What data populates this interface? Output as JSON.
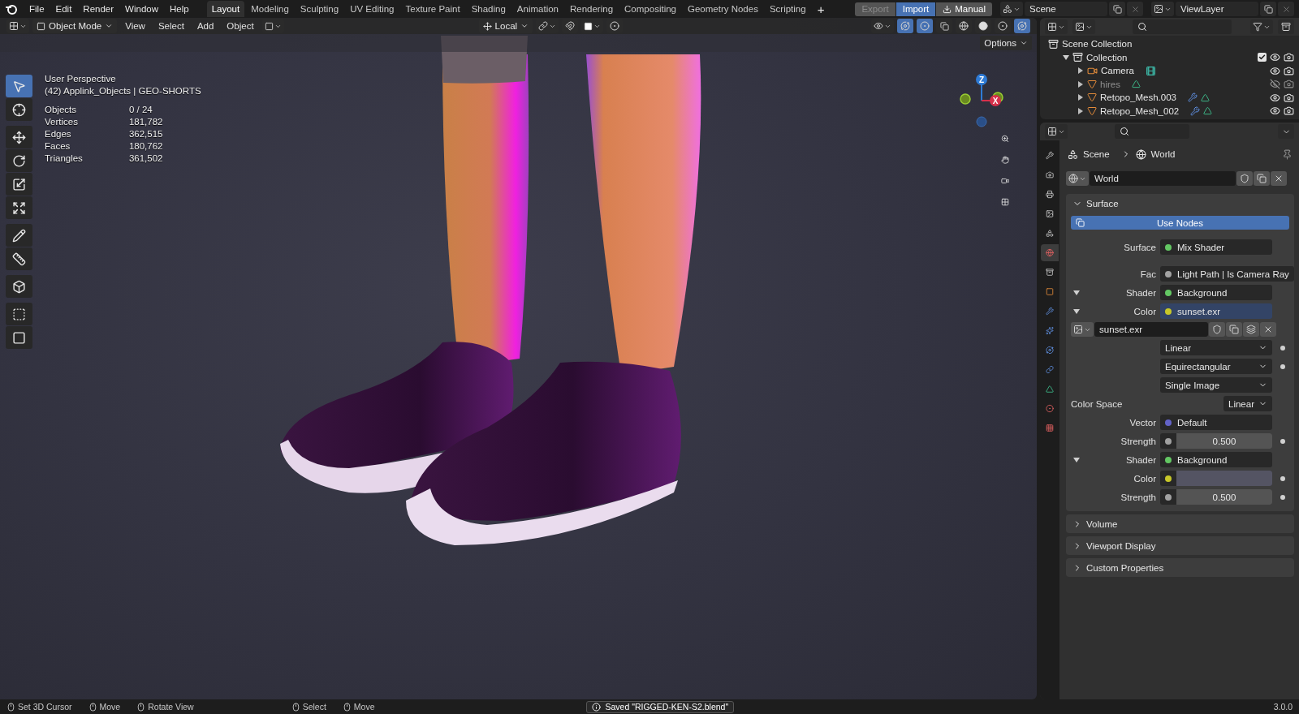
{
  "menu": [
    "File",
    "Edit",
    "Render",
    "Window",
    "Help"
  ],
  "workspaces": [
    {
      "label": "Layout",
      "selected": true
    },
    {
      "label": "Modeling",
      "selected": false
    },
    {
      "label": "Sculpting",
      "selected": false
    },
    {
      "label": "UV Editing",
      "selected": false
    },
    {
      "label": "Texture Paint",
      "selected": false
    },
    {
      "label": "Shading",
      "selected": false
    },
    {
      "label": "Animation",
      "selected": false
    },
    {
      "label": "Rendering",
      "selected": false
    },
    {
      "label": "Compositing",
      "selected": false
    },
    {
      "label": "Geometry Nodes",
      "selected": false
    },
    {
      "label": "Scripting",
      "selected": false
    }
  ],
  "add_workspace": "+",
  "addon_buttons": [
    {
      "label": "Export",
      "kind": "export",
      "disabled": true
    },
    {
      "label": "Import",
      "kind": "import",
      "disabled": false
    },
    {
      "label": "Manual",
      "kind": "manual",
      "disabled": false
    }
  ],
  "scene": "Scene",
  "view_layer": "ViewLayer",
  "viewport": {
    "mode": "Object Mode",
    "menus": [
      "View",
      "Select",
      "Add",
      "Object"
    ],
    "orientation": "Local",
    "options": "Options",
    "title": "User Perspective",
    "context": "(42) Applink_Objects | GEO-SHORTS",
    "stats": [
      {
        "label": "Objects",
        "value": "0 / 24"
      },
      {
        "label": "Vertices",
        "value": "181,782"
      },
      {
        "label": "Edges",
        "value": "362,515"
      },
      {
        "label": "Faces",
        "value": "180,762"
      },
      {
        "label": "Triangles",
        "value": "361,502"
      }
    ],
    "gizmo": {
      "z": "Z",
      "x": "X"
    },
    "tool_groups": [
      [
        {
          "kind": "select",
          "selected": true
        },
        {
          "kind": "cursor",
          "selected": false
        }
      ],
      [
        {
          "kind": "move",
          "selected": false
        },
        {
          "kind": "rotate",
          "selected": false
        },
        {
          "kind": "scale",
          "selected": false
        },
        {
          "kind": "transform",
          "selected": false
        }
      ],
      [
        {
          "kind": "annotate",
          "selected": false
        },
        {
          "kind": "measure",
          "selected": false
        }
      ],
      [
        {
          "kind": "add-cube",
          "selected": false
        }
      ],
      [
        {
          "kind": "shrink",
          "selected": false
        },
        {
          "kind": "bevel",
          "selected": false
        }
      ]
    ]
  },
  "outliner": {
    "items": [
      {
        "label": "Scene Collection",
        "kind": "scene-collection",
        "children": [
          {
            "label": "Collection",
            "kind": "collection",
            "expanded": true,
            "checked": true,
            "visible": true,
            "children": [
              {
                "label": "Camera",
                "kind": "camera",
                "expanded": false,
                "visible": true
              },
              {
                "label": "hires",
                "kind": "mesh",
                "expanded": false,
                "visible": false
              },
              {
                "label": "Retopo_Mesh.003",
                "kind": "mesh",
                "expanded": false,
                "visible": true
              },
              {
                "label": "Retopo_Mesh_002",
                "kind": "mesh",
                "expanded": false,
                "visible": true
              }
            ]
          }
        ]
      }
    ]
  },
  "properties": {
    "tabs": [
      {
        "kind": "tool",
        "selected": false
      },
      {
        "kind": "render",
        "selected": false
      },
      {
        "kind": "output",
        "selected": false
      },
      {
        "kind": "view-layer",
        "selected": false
      },
      {
        "kind": "scene",
        "selected": false
      },
      {
        "kind": "world",
        "selected": true
      },
      {
        "kind": "collection",
        "selected": false
      },
      {
        "kind": "object",
        "selected": false
      },
      {
        "kind": "modifiers",
        "selected": false
      },
      {
        "kind": "particles",
        "selected": false
      },
      {
        "kind": "physics",
        "selected": false
      },
      {
        "kind": "constraints",
        "selected": false
      },
      {
        "kind": "data",
        "selected": false
      },
      {
        "kind": "material",
        "selected": false
      },
      {
        "kind": "texture",
        "selected": false
      }
    ],
    "breadcrumb": [
      "Scene",
      "World"
    ],
    "datablock": "World",
    "surface": {
      "title": "Surface",
      "expanded": true,
      "use_nodes": "Use Nodes",
      "rows": [
        {
          "kind": "socket",
          "label": "Surface",
          "color": "#63c763",
          "value": "Mix Shader",
          "highlighted": false
        },
        {
          "kind": "socket",
          "label": "Fac",
          "color": "#a1a1a1",
          "value": "Light Path | Is Camera Ray",
          "highlighted": false
        },
        {
          "kind": "socket",
          "label": "Shader",
          "color": "#63c763",
          "value": "Background",
          "highlighted": false,
          "expanded": true
        },
        {
          "kind": "socket",
          "label": "Color",
          "color": "#c7c729",
          "value": "sunset.exr",
          "highlighted": true,
          "expanded": true
        },
        {
          "kind": "image",
          "value": "sunset.exr"
        },
        {
          "kind": "dropdown",
          "value": "Linear",
          "keyframe": true
        },
        {
          "kind": "dropdown",
          "value": "Equirectangular",
          "keyframe": true
        },
        {
          "kind": "dropdown",
          "value": "Single Image"
        },
        {
          "kind": "colorspace",
          "label": "Color Space",
          "value": "Linear"
        },
        {
          "kind": "socket",
          "label": "Vector",
          "color": "#6363c7",
          "value": "Default",
          "highlighted": false
        },
        {
          "kind": "number",
          "label": "Strength",
          "color": "#a1a1a1",
          "value": "0.500",
          "keyframe": true
        },
        {
          "kind": "socket",
          "label": "Shader",
          "color": "#63c763",
          "value": "Background",
          "highlighted": false,
          "expanded": true
        },
        {
          "kind": "swatch",
          "label": "Color",
          "color": "#c7c729",
          "keyframe": true
        },
        {
          "kind": "number",
          "label": "Strength",
          "color": "#a1a1a1",
          "value": "0.500",
          "keyframe": true
        }
      ]
    },
    "panels": [
      {
        "title": "Volume",
        "expanded": false
      },
      {
        "title": "Viewport Display",
        "expanded": false
      },
      {
        "title": "Custom Properties",
        "expanded": false
      }
    ]
  },
  "status_bar": {
    "hints": [
      {
        "label": "Set 3D Cursor"
      },
      {
        "label": "Move"
      },
      {
        "label": "Rotate View"
      },
      {
        "label": "Select"
      },
      {
        "label": "Move"
      }
    ],
    "message": "Saved \"RIGGED-KEN-S2.blend\"",
    "version": "3.0.0"
  }
}
